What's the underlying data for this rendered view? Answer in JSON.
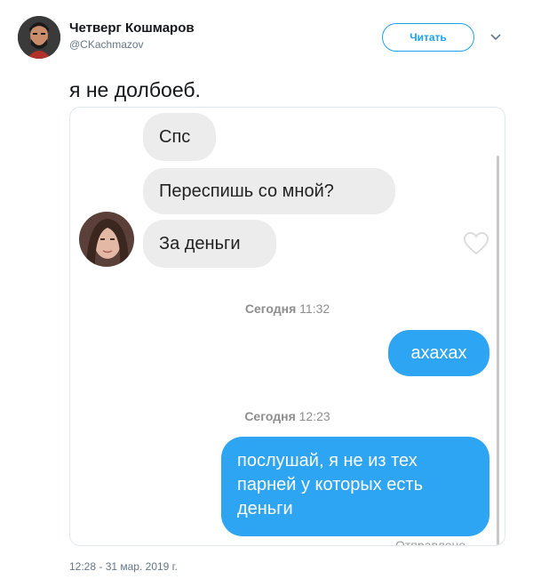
{
  "author": {
    "name": "Четверг Кошмаров",
    "handle": "@CKachmazov"
  },
  "follow_label": "Читать",
  "tweet_text": "я не долбоеб.",
  "chat": {
    "incoming": [
      "Спс",
      "Переспишь со мной?",
      "За деньги"
    ],
    "timestamp_1": {
      "day": "Сегодня",
      "time": "11:32"
    },
    "outgoing_1": "ахахах",
    "timestamp_2": {
      "day": "Сегодня",
      "time": "12:23"
    },
    "outgoing_2": "послушай, я не из тех парней у которых есть деньги",
    "sent_status": "Отправлено"
  },
  "tweet_date": "12:28 - 31 мар. 2019 г.",
  "icons": [
    "caret-down-icon",
    "heart-icon"
  ],
  "colors": {
    "accent": "#1da1f2",
    "outgoing_bubble": "#2ea5f2",
    "incoming_bubble": "#ececec"
  }
}
